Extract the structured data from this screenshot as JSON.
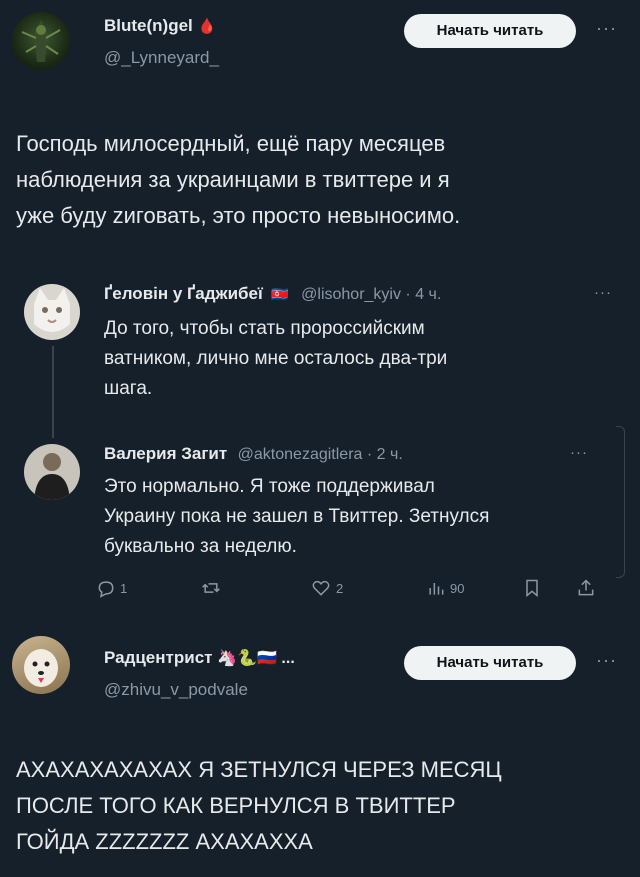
{
  "post1": {
    "author_name": "Blute(n)gel",
    "author_emoji": "🩸",
    "handle": "@_Lynneyard_",
    "follow_button": "Начать читать",
    "more": "···",
    "text_lines": [
      "Господь милосердный, ещё пару месяцев",
      "наблюдения за украинцами в твиттере и я",
      "уже буду zиговать, это просто невыносимо."
    ]
  },
  "quoted1": {
    "author_name": "Ґеловін у Ґаджибеї",
    "flag_emoji": "🇰🇵",
    "handle": "@lisohor_kyiv · 4 ч.",
    "more": "···",
    "text_lines": [
      "До того, чтобы стать пророссийским",
      "ватником, лично мне осталось два-три",
      "шага."
    ]
  },
  "reply1": {
    "author_name": "Валерия Загит",
    "handle": "@aktonezagitlera · 2 ч.",
    "more": "···",
    "text_lines": [
      "Это нормально. Я тоже поддерживал",
      "Украину пока не зашел в Твиттер. Зетнулся",
      "буквально за неделю."
    ],
    "actions": {
      "replies": "1",
      "retweets": "",
      "likes": "2",
      "views": "90"
    }
  },
  "post2": {
    "author_name": "Радцентрист",
    "author_emojis": "🦄🐍🇷🇺 ...",
    "handle": "@zhivu_v_podvale",
    "follow_button": "Начать читать",
    "more": "···",
    "text_lines": [
      "АХАХАХАХАХАХ Я ЗЕТНУЛСЯ ЧЕРЕЗ МЕСЯЦ",
      "ПОСЛЕ ТОГО КАК ВЕРНУЛСЯ В ТВИТТЕР",
      "ГОЙДА ZZZZZZZ АХАХАХХА"
    ]
  }
}
